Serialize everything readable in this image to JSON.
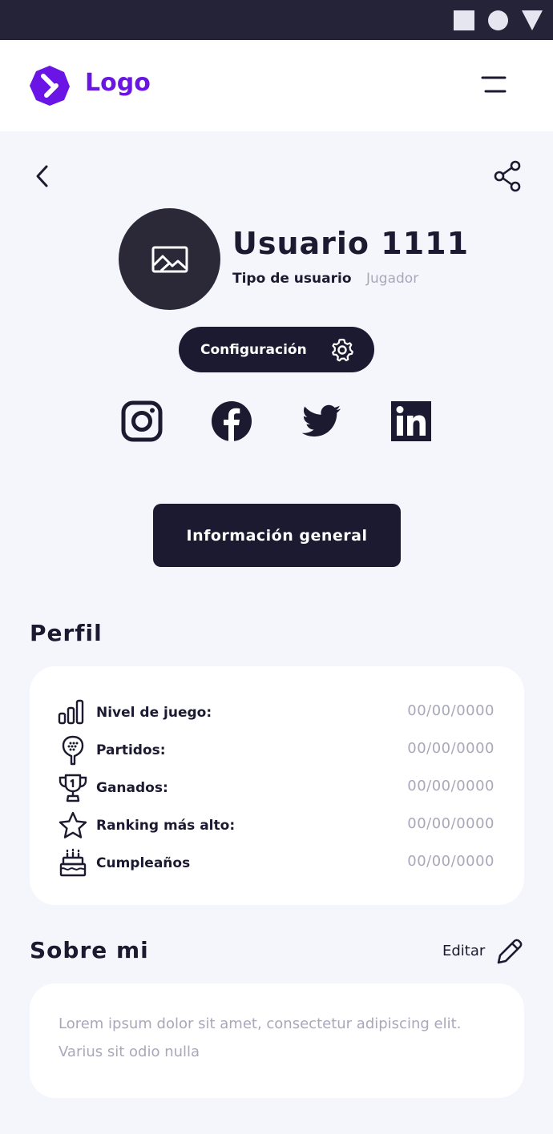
{
  "status_bar": {
    "icons": [
      "square-icon",
      "circle-icon",
      "triangle-icon"
    ]
  },
  "header": {
    "logo_text": "Logo",
    "menu_icon": "hamburger-menu-icon"
  },
  "nav": {
    "back_icon": "chevron-left-icon",
    "share_icon": "share-icon"
  },
  "profile": {
    "name": "Usuario 1111",
    "type_label": "Tipo de usuario",
    "type_value": "Jugador",
    "avatar_icon": "image-placeholder-icon",
    "config_label": "Configuración"
  },
  "social": [
    "instagram-icon",
    "facebook-icon",
    "twitter-icon",
    "linkedin-icon"
  ],
  "info_button_label": "Información general",
  "perfil": {
    "title": "Perfil",
    "rows": [
      {
        "label": "Nivel de juego:",
        "value": "00/00/0000",
        "icon": "bar-chart-icon"
      },
      {
        "label": "Partidos:",
        "value": "00/00/0000",
        "icon": "padel-racket-icon"
      },
      {
        "label": "Ganados:",
        "value": "00/00/0000",
        "icon": "trophy-icon"
      },
      {
        "label": "Ranking más alto:",
        "value": "00/00/0000",
        "icon": "star-icon"
      },
      {
        "label": "Cumpleaños",
        "value": "00/00/0000",
        "icon": "cake-icon"
      }
    ]
  },
  "sobre": {
    "title": "Sobre mi",
    "edit_label": "Editar",
    "text": "Lorem ipsum dolor sit amet, consectetur adipiscing elit. Varius sit odio nulla"
  },
  "colors": {
    "dark": "#1b1a30",
    "brand": "#6a14e6",
    "muted": "#a8a8ba",
    "background": "#f5f5fc"
  }
}
